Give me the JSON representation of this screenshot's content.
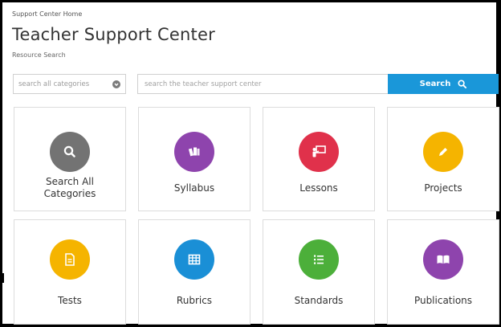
{
  "breadcrumb": "Support Center Home",
  "title": "Teacher Support Center",
  "subtitle": "Resource Search",
  "search": {
    "category_placeholder": "search all categories",
    "input_placeholder": "search the teacher support center",
    "button_label": "Search"
  },
  "cards": [
    {
      "label": "Search All Categories",
      "icon": "search-icon",
      "color": "#737373"
    },
    {
      "label": "Syllabus",
      "icon": "books-icon",
      "color": "#8e44ad"
    },
    {
      "label": "Lessons",
      "icon": "presentation-icon",
      "color": "#e0314b"
    },
    {
      "label": "Projects",
      "icon": "pencil-icon",
      "color": "#f5b400"
    },
    {
      "label": "Tests",
      "icon": "document-icon",
      "color": "#f5b400"
    },
    {
      "label": "Rubrics",
      "icon": "grid-icon",
      "color": "#1a8fd6"
    },
    {
      "label": "Standards",
      "icon": "list-icon",
      "color": "#4caf3a"
    },
    {
      "label": "Publications",
      "icon": "open-book-icon",
      "color": "#8e44ad"
    }
  ],
  "colors": {
    "search_button": "#1a97d9",
    "border": "#dcdcdc"
  }
}
